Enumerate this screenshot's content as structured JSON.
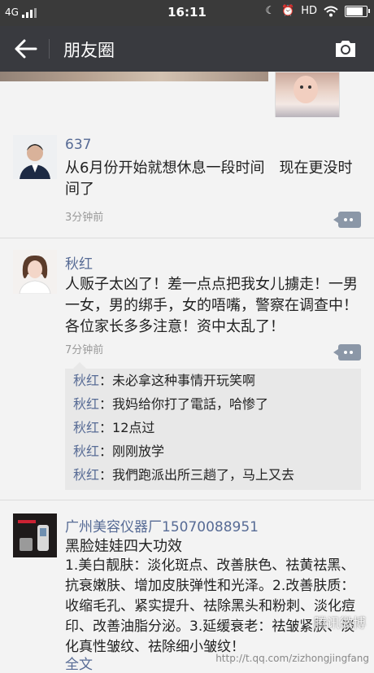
{
  "status_bar": {
    "network": "4G",
    "time": "16:11",
    "hd": "HD"
  },
  "nav": {
    "title": "朋友圈"
  },
  "posts": [
    {
      "name": "637",
      "text": "从6月份开始就想休息一段时间　现在更没时间了",
      "time": "3分钟前"
    },
    {
      "name": "秋红",
      "text": "人贩子太凶了！差一点点把我女儿擄走！一男一女，男的绑手，女的唔嘴，警察在调查中！各位家长多多注意！资中太乱了！",
      "time": "7分钟前",
      "comments": [
        {
          "name": "秋红",
          "sep": "：",
          "text": "未必拿这种事情开玩笑啊"
        },
        {
          "name": "秋红",
          "sep": "：",
          "text": "我妈给你打了電話，哈惨了"
        },
        {
          "name": "秋红",
          "sep": "：",
          "text": "12点过"
        },
        {
          "name": "秋红",
          "sep": "：",
          "text": "刚刚放学"
        },
        {
          "name": "秋红",
          "sep": "：",
          "text": "我們跑派出所三趟了，马上又去"
        }
      ]
    },
    {
      "name": "广州美容仪器厂15070088951",
      "text_title": "黑脸娃娃四大功效",
      "text": "1.美白靓肤：淡化斑点、改善肤色、祛黄祛黑、抗衰嫩肤、增加皮肤弹性和光泽。2.改善肤质：收缩毛孔、紧实提升、祛除黑头和粉刺、淡化痘印、改善油脂分泌。3.延缓衰老：祛皱紧肤、淡化真性皱纹、祛除细小皱纹！",
      "more": "全文"
    }
  ],
  "watermark": "http://t.qq.com/zizhongjingfang",
  "watermark_logo": "腾讯微博"
}
